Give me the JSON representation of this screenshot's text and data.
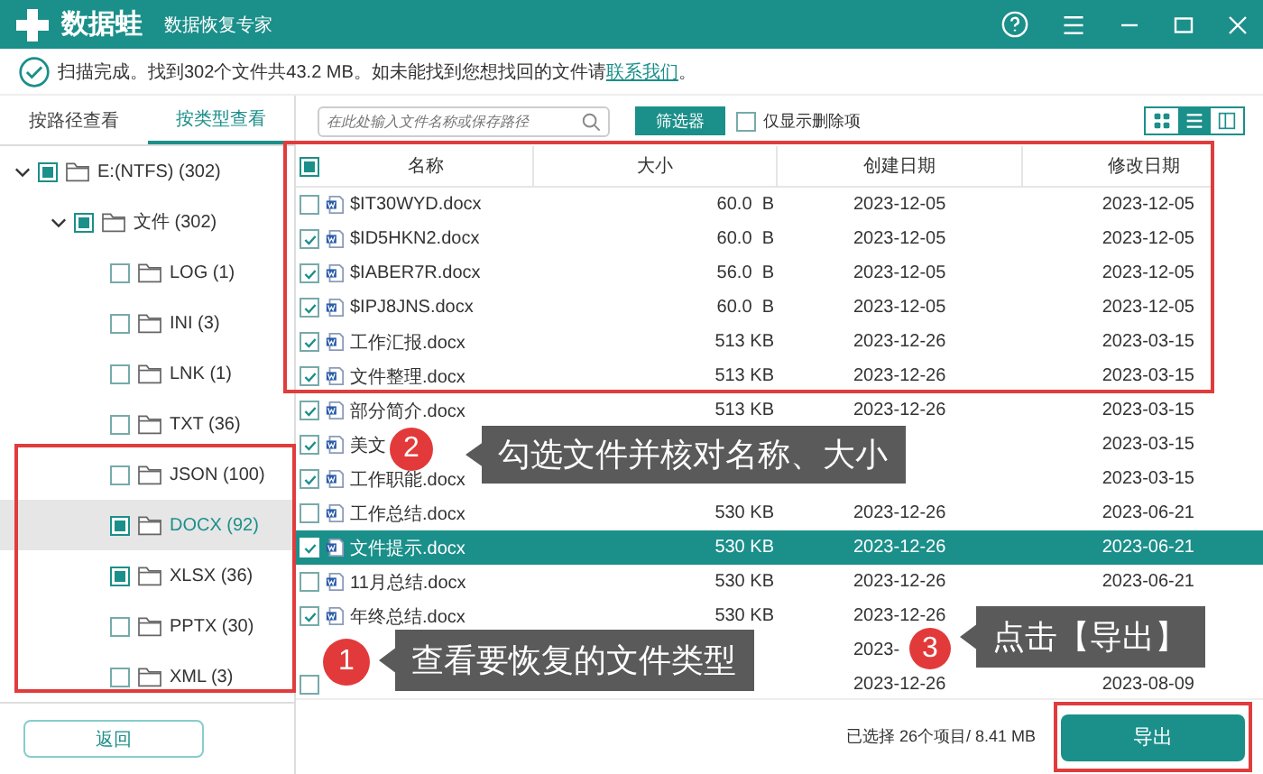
{
  "app": {
    "name": "数据蛙",
    "subtitle": "数据恢复专家"
  },
  "scan_status": {
    "text": "扫描完成。找到302个文件共43.2 MB。如未能找到您想找回的文件请",
    "link": "联系我们",
    "after": "。"
  },
  "view_tabs": [
    {
      "label": "按路径查看",
      "selected": false
    },
    {
      "label": "按类型查看",
      "selected": true
    }
  ],
  "tree": [
    {
      "label": "E:(NTFS) (302)",
      "checked": true,
      "expanded": true,
      "selected": false,
      "children": [
        {
          "label": "文件 (302)",
          "checked": true,
          "expanded": true,
          "selected": false,
          "children": [
            {
              "label": "LOG (1)",
              "checked": false,
              "selected": false
            },
            {
              "label": "INI (3)",
              "checked": false,
              "selected": false
            },
            {
              "label": "LNK (1)",
              "checked": false,
              "selected": false
            },
            {
              "label": "TXT (36)",
              "checked": false,
              "selected": false
            },
            {
              "label": "JSON (100)",
              "checked": false,
              "selected": false
            },
            {
              "label": "DOCX (92)",
              "checked": true,
              "selected": true
            },
            {
              "label": "XLSX (36)",
              "checked": true,
              "selected": false
            },
            {
              "label": "PPTX (30)",
              "checked": false,
              "selected": false
            },
            {
              "label": "XML (3)",
              "checked": false,
              "selected": false
            }
          ]
        }
      ]
    }
  ],
  "back_button": "返回",
  "search": {
    "placeholder": "在此处输入文件名称或保存路径"
  },
  "filter_button": "筛选器",
  "deleted_only": {
    "label": "仅显示删除项",
    "checked": false
  },
  "view_modes": [
    {
      "kind": "grid",
      "selected": false
    },
    {
      "kind": "list",
      "selected": true
    },
    {
      "kind": "preview",
      "selected": false
    }
  ],
  "table": {
    "select_all": true,
    "columns": [
      "名称",
      "大小",
      "创建日期",
      "修改日期"
    ],
    "rows": [
      {
        "name": "$IT30WYD.docx",
        "size": "60.0  B",
        "created": "2023-12-05",
        "modified": "2023-12-05",
        "checked": false,
        "selected": false
      },
      {
        "name": "$ID5HKN2.docx",
        "size": "60.0  B",
        "created": "2023-12-05",
        "modified": "2023-12-05",
        "checked": true,
        "selected": false
      },
      {
        "name": "$IABER7R.docx",
        "size": "56.0  B",
        "created": "2023-12-05",
        "modified": "2023-12-05",
        "checked": true,
        "selected": false
      },
      {
        "name": "$IPJ8JNS.docx",
        "size": "60.0  B",
        "created": "2023-12-05",
        "modified": "2023-12-05",
        "checked": true,
        "selected": false
      },
      {
        "name": "工作汇报.docx",
        "size": "513 KB",
        "created": "2023-12-26",
        "modified": "2023-03-15",
        "checked": true,
        "selected": false
      },
      {
        "name": "文件整理.docx",
        "size": "513 KB",
        "created": "2023-12-26",
        "modified": "2023-03-15",
        "checked": true,
        "selected": false
      },
      {
        "name": "部分简介.docx",
        "size": "513 KB",
        "created": "2023-12-26",
        "modified": "2023-03-15",
        "checked": true,
        "selected": false
      },
      {
        "name": "美文",
        "modified": "2023-03-15",
        "checked": true,
        "selected": false
      },
      {
        "name": "工作职能.docx",
        "modified": "2023-03-15",
        "checked": true,
        "selected": false
      },
      {
        "name": "工作总结.docx",
        "size": "530 KB",
        "created": "2023-12-26",
        "modified": "2023-06-21",
        "checked": false,
        "selected": false
      },
      {
        "name": "文件提示.docx",
        "size": "530 KB",
        "created": "2023-12-26",
        "modified": "2023-06-21",
        "checked": true,
        "selected": true
      },
      {
        "name": "11月总结.docx",
        "size": "530 KB",
        "created": "2023-12-26",
        "modified": "2023-06-21",
        "checked": false,
        "selected": false
      },
      {
        "name": "年终总结.docx",
        "size": "530 KB",
        "created": "2023-12-26",
        "checked": true,
        "selected": false
      },
      {
        "created": "2023-",
        "selected": false
      },
      {
        "created": "2023-12-26",
        "modified": "2023-08-09",
        "checked": false,
        "selected": false
      }
    ]
  },
  "status": "已选择 26个项目/ 8.41 MB",
  "export_button": "导出",
  "callouts": [
    {
      "number": "2",
      "text": "勾选文件并核对名称、大小"
    },
    {
      "number": "1",
      "text": "查看要恢复的文件类型"
    },
    {
      "number": "3",
      "text": "点击【导出】"
    }
  ]
}
